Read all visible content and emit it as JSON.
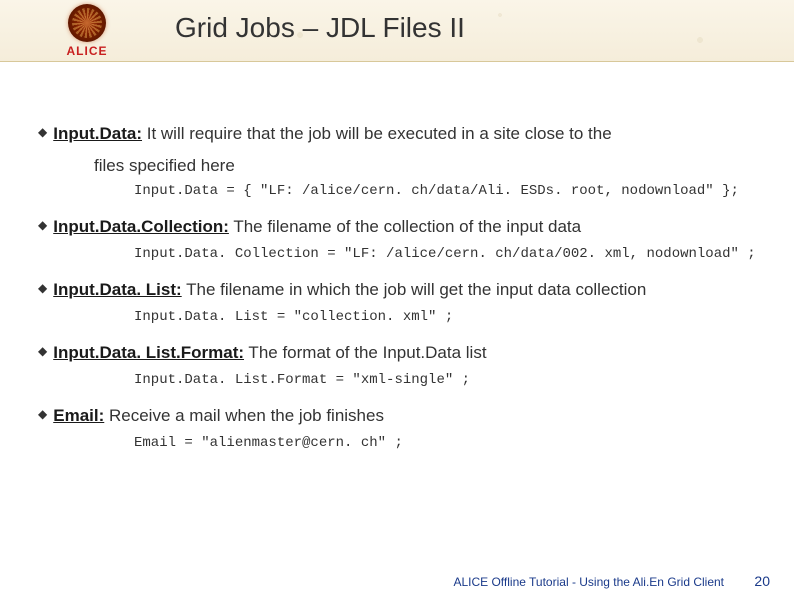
{
  "header": {
    "logo_text": "ALICE",
    "title": "Grid Jobs – JDL Files II"
  },
  "bullets": [
    {
      "term": "Input.Data:",
      "desc_inline": " It will require that the job will be executed in a site close to the",
      "desc_cont": "files specified here",
      "code": "Input.Data = { \"LF: /alice/cern. ch/data/Ali. ESDs. root, nodownload\" };"
    },
    {
      "term": "Input.Data.Collection:",
      "desc_inline": " The filename of the collection of the input data",
      "desc_cont": "",
      "code": "Input.Data. Collection = \"LF: /alice/cern. ch/data/002. xml, nodownload\" ;"
    },
    {
      "term": "Input.Data. List:",
      "desc_inline": " The filename in which the job will get the input data collection",
      "desc_cont": "",
      "code": "Input.Data. List = \"collection. xml\" ;"
    },
    {
      "term": "Input.Data. List.Format:",
      "desc_inline": " The format of the Input.Data list",
      "desc_cont": "",
      "code": "Input.Data. List.Format = \"xml-single\" ;"
    },
    {
      "term": "Email:",
      "desc_inline": " Receive a mail when the job finishes",
      "desc_cont": "",
      "code": "Email = \"alienmaster@cern. ch\" ;"
    }
  ],
  "footer": {
    "text": "ALICE Offline Tutorial - Using the Ali.En Grid Client",
    "page": "20"
  }
}
